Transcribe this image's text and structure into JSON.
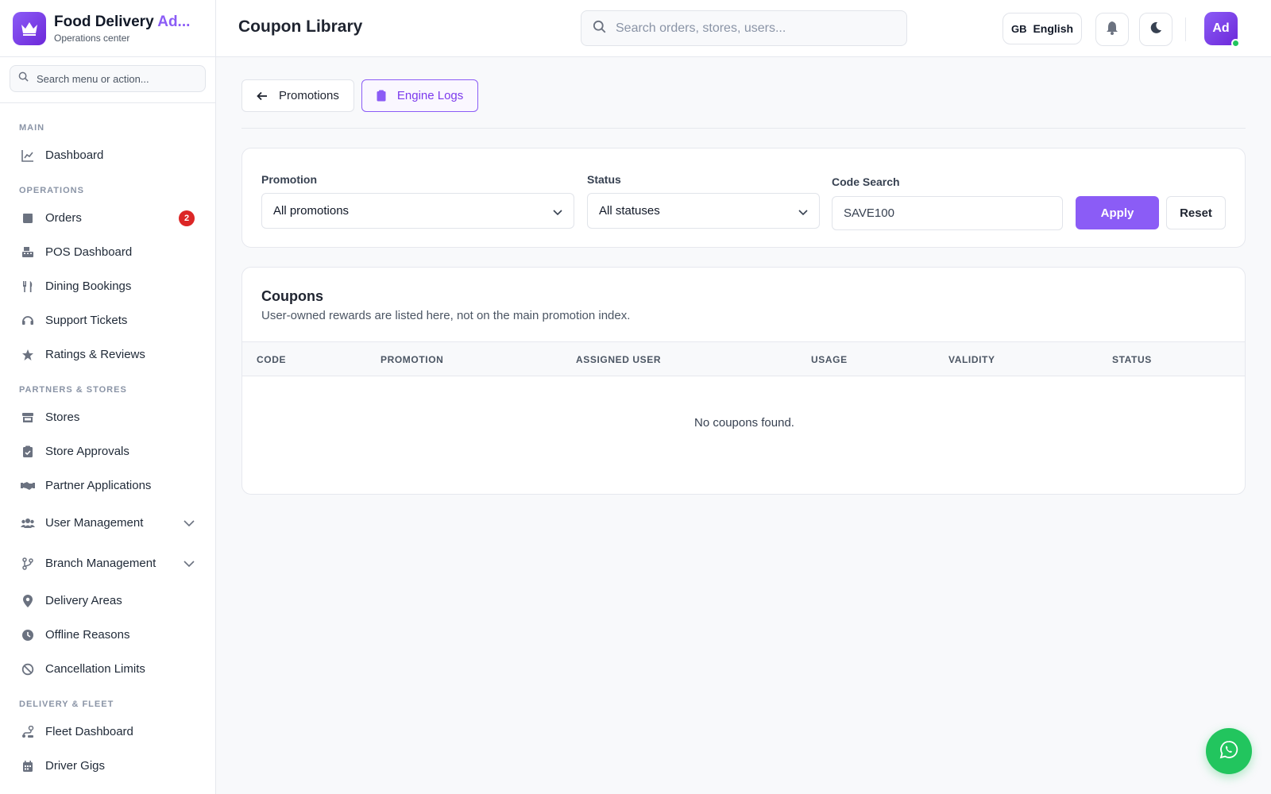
{
  "brand": {
    "title_main": "Food Delivery ",
    "title_accent": "Ad...",
    "subtitle": "Operations center"
  },
  "sidebar": {
    "search_placeholder": "Search menu or action...",
    "sections": {
      "main": "MAIN",
      "operations": "OPERATIONS",
      "partners": "PARTNERS & STORES",
      "fleet": "DELIVERY & FLEET"
    },
    "items": {
      "dashboard": "Dashboard",
      "orders": "Orders",
      "orders_badge": "2",
      "pos": "POS Dashboard",
      "dining": "Dining Bookings",
      "support": "Support Tickets",
      "ratings": "Ratings & Reviews",
      "stores": "Stores",
      "store_approvals": "Store Approvals",
      "partner_apps": "Partner Applications",
      "user_mgmt": "User Management",
      "branch_mgmt": "Branch Management",
      "delivery_areas": "Delivery Areas",
      "offline_reasons": "Offline Reasons",
      "cancellation": "Cancellation Limits",
      "fleet_dashboard": "Fleet Dashboard",
      "driver_gigs": "Driver Gigs"
    }
  },
  "header": {
    "title": "Coupon Library",
    "search_placeholder": "Search orders, stores, users...",
    "lang_code": "GB",
    "lang_label": "English",
    "avatar_initials": "Ad"
  },
  "tabs": {
    "promotions": "Promotions",
    "engine_logs": "Engine Logs"
  },
  "filters": {
    "promotion_label": "Promotion",
    "promotion_value": "All promotions",
    "status_label": "Status",
    "status_value": "All statuses",
    "code_label": "Code Search",
    "code_value": "SAVE100",
    "apply": "Apply",
    "reset": "Reset"
  },
  "coupons": {
    "title": "Coupons",
    "subtitle": "User-owned rewards are listed here, not on the main promotion index.",
    "columns": [
      "CODE",
      "PROMOTION",
      "ASSIGNED USER",
      "USAGE",
      "VALIDITY",
      "STATUS"
    ],
    "empty": "No coupons found."
  },
  "colors": {
    "accent": "#8b5cf6",
    "badge": "#dc2626",
    "whatsapp": "#22c55e"
  }
}
